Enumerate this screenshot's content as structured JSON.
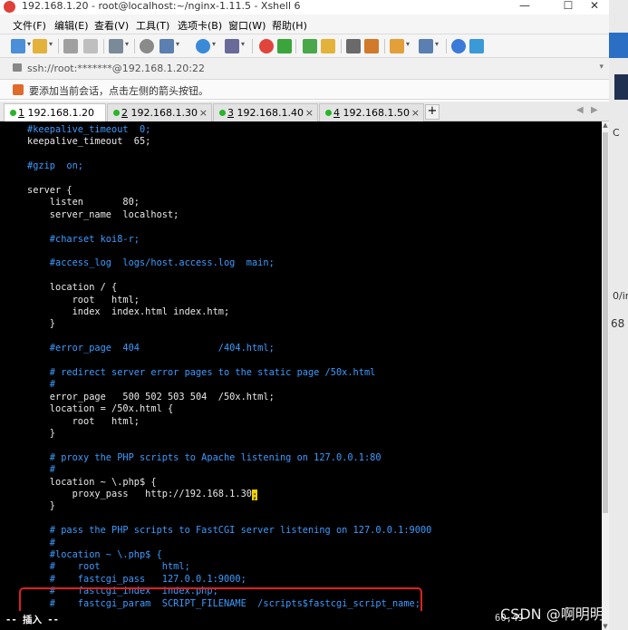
{
  "window": {
    "title": "192.168.1.20 - root@localhost:~/nginx-1.11.5 - Xshell 6"
  },
  "menu": [
    "文件(F)",
    "编辑(E)",
    "查看(V)",
    "工具(T)",
    "选项卡(B)",
    "窗口(W)",
    "帮助(H)"
  ],
  "address": {
    "value": "ssh://root:*******@192.168.1.20:22"
  },
  "hint": "要添加当前会话，点击左侧的箭头按钮。",
  "tabs": [
    {
      "num": "1",
      "host": "192.168.1.20",
      "active": true
    },
    {
      "num": "2",
      "host": "192.168.1.30",
      "active": false
    },
    {
      "num": "3",
      "host": "192.168.1.40",
      "active": false
    },
    {
      "num": "4",
      "host": "192.168.1.50",
      "active": false
    }
  ],
  "terminal": {
    "lines": [
      {
        "t": "#keepalive_timeout  0;",
        "c": "comment"
      },
      {
        "t": "keepalive_timeout  65;",
        "c": "code"
      },
      {
        "t": "",
        "c": "code"
      },
      {
        "t": "#gzip  on;",
        "c": "comment"
      },
      {
        "t": "",
        "c": "code"
      },
      {
        "t": "server {",
        "c": "code"
      },
      {
        "t": "    listen       80;",
        "c": "code"
      },
      {
        "t": "    server_name  localhost;",
        "c": "code"
      },
      {
        "t": "",
        "c": "code"
      },
      {
        "t": "    #charset koi8-r;",
        "c": "comment"
      },
      {
        "t": "",
        "c": "code"
      },
      {
        "t": "    #access_log  logs/host.access.log  main;",
        "c": "comment"
      },
      {
        "t": "",
        "c": "code"
      },
      {
        "t": "    location / {",
        "c": "code"
      },
      {
        "t": "        root   html;",
        "c": "code"
      },
      {
        "t": "        index  index.html index.htm;",
        "c": "code"
      },
      {
        "t": "    }",
        "c": "code"
      },
      {
        "t": "",
        "c": "code"
      },
      {
        "t": "    #error_page  404              /404.html;",
        "c": "comment"
      },
      {
        "t": "",
        "c": "code"
      },
      {
        "t": "    # redirect server error pages to the static page /50x.html",
        "c": "comment"
      },
      {
        "t": "    #",
        "c": "comment"
      },
      {
        "t": "    error_page   500 502 503 504  /50x.html;",
        "c": "code"
      },
      {
        "t": "    location = /50x.html {",
        "c": "code"
      },
      {
        "t": "        root   html;",
        "c": "code"
      },
      {
        "t": "    }",
        "c": "code"
      },
      {
        "t": "",
        "c": "code"
      },
      {
        "t": "    # proxy the PHP scripts to Apache listening on 127.0.0.1:80",
        "c": "comment"
      },
      {
        "t": "    #",
        "c": "comment"
      },
      {
        "t": "    location ~ \\.php$ {",
        "c": "code"
      },
      {
        "t": "        proxy_pass   http://192.168.1.30",
        "c": "code",
        "cursor": ";"
      },
      {
        "t": "    }",
        "c": "code"
      },
      {
        "t": "",
        "c": "code"
      },
      {
        "t": "    # pass the PHP scripts to FastCGI server listening on 127.0.0.1:9000",
        "c": "comment"
      },
      {
        "t": "    #",
        "c": "comment"
      },
      {
        "t": "    #location ~ \\.php$ {",
        "c": "comment"
      },
      {
        "t": "    #    root           html;",
        "c": "comment"
      },
      {
        "t": "    #    fastcgi_pass   127.0.0.1:9000;",
        "c": "comment"
      },
      {
        "t": "    #    fastcgi_index  index.php;",
        "c": "comment"
      },
      {
        "t": "    #    fastcgi_param  SCRIPT_FILENAME  /scripts$fastcgi_script_name;",
        "c": "comment"
      }
    ],
    "mode": "-- 插入 --",
    "position": "60,49",
    "highlight_color": "#e0201e"
  },
  "right_edge": {
    "c": "C",
    "lnum1": "0/in",
    "lnum2": "68"
  },
  "watermark": "CSDN @啊明明！",
  "colors": {
    "comment": "#3b9bff",
    "code": "#e8e8e8",
    "cursor": "#f0d000",
    "tab_dot": "#28b528"
  }
}
